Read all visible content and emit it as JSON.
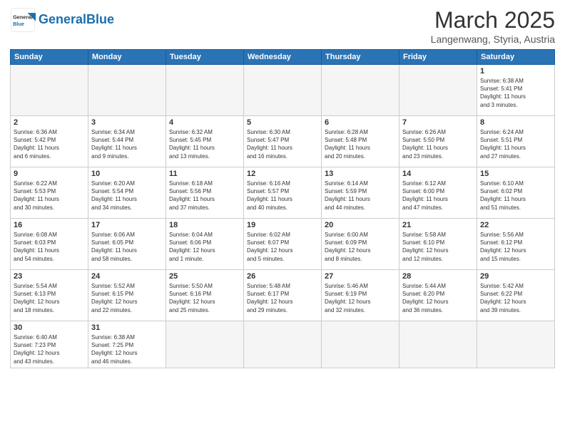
{
  "logo": {
    "text_general": "General",
    "text_blue": "Blue"
  },
  "title": "March 2025",
  "subtitle": "Langenwang, Styria, Austria",
  "weekdays": [
    "Sunday",
    "Monday",
    "Tuesday",
    "Wednesday",
    "Thursday",
    "Friday",
    "Saturday"
  ],
  "weeks": [
    [
      {
        "day": "",
        "info": ""
      },
      {
        "day": "",
        "info": ""
      },
      {
        "day": "",
        "info": ""
      },
      {
        "day": "",
        "info": ""
      },
      {
        "day": "",
        "info": ""
      },
      {
        "day": "",
        "info": ""
      },
      {
        "day": "1",
        "info": "Sunrise: 6:38 AM\nSunset: 5:41 PM\nDaylight: 11 hours\nand 3 minutes."
      }
    ],
    [
      {
        "day": "2",
        "info": "Sunrise: 6:36 AM\nSunset: 5:42 PM\nDaylight: 11 hours\nand 6 minutes."
      },
      {
        "day": "3",
        "info": "Sunrise: 6:34 AM\nSunset: 5:44 PM\nDaylight: 11 hours\nand 9 minutes."
      },
      {
        "day": "4",
        "info": "Sunrise: 6:32 AM\nSunset: 5:45 PM\nDaylight: 11 hours\nand 13 minutes."
      },
      {
        "day": "5",
        "info": "Sunrise: 6:30 AM\nSunset: 5:47 PM\nDaylight: 11 hours\nand 16 minutes."
      },
      {
        "day": "6",
        "info": "Sunrise: 6:28 AM\nSunset: 5:48 PM\nDaylight: 11 hours\nand 20 minutes."
      },
      {
        "day": "7",
        "info": "Sunrise: 6:26 AM\nSunset: 5:50 PM\nDaylight: 11 hours\nand 23 minutes."
      },
      {
        "day": "8",
        "info": "Sunrise: 6:24 AM\nSunset: 5:51 PM\nDaylight: 11 hours\nand 27 minutes."
      }
    ],
    [
      {
        "day": "9",
        "info": "Sunrise: 6:22 AM\nSunset: 5:53 PM\nDaylight: 11 hours\nand 30 minutes."
      },
      {
        "day": "10",
        "info": "Sunrise: 6:20 AM\nSunset: 5:54 PM\nDaylight: 11 hours\nand 34 minutes."
      },
      {
        "day": "11",
        "info": "Sunrise: 6:18 AM\nSunset: 5:56 PM\nDaylight: 11 hours\nand 37 minutes."
      },
      {
        "day": "12",
        "info": "Sunrise: 6:16 AM\nSunset: 5:57 PM\nDaylight: 11 hours\nand 40 minutes."
      },
      {
        "day": "13",
        "info": "Sunrise: 6:14 AM\nSunset: 5:59 PM\nDaylight: 11 hours\nand 44 minutes."
      },
      {
        "day": "14",
        "info": "Sunrise: 6:12 AM\nSunset: 6:00 PM\nDaylight: 11 hours\nand 47 minutes."
      },
      {
        "day": "15",
        "info": "Sunrise: 6:10 AM\nSunset: 6:02 PM\nDaylight: 11 hours\nand 51 minutes."
      }
    ],
    [
      {
        "day": "16",
        "info": "Sunrise: 6:08 AM\nSunset: 6:03 PM\nDaylight: 11 hours\nand 54 minutes."
      },
      {
        "day": "17",
        "info": "Sunrise: 6:06 AM\nSunset: 6:05 PM\nDaylight: 11 hours\nand 58 minutes."
      },
      {
        "day": "18",
        "info": "Sunrise: 6:04 AM\nSunset: 6:06 PM\nDaylight: 12 hours\nand 1 minute."
      },
      {
        "day": "19",
        "info": "Sunrise: 6:02 AM\nSunset: 6:07 PM\nDaylight: 12 hours\nand 5 minutes."
      },
      {
        "day": "20",
        "info": "Sunrise: 6:00 AM\nSunset: 6:09 PM\nDaylight: 12 hours\nand 8 minutes."
      },
      {
        "day": "21",
        "info": "Sunrise: 5:58 AM\nSunset: 6:10 PM\nDaylight: 12 hours\nand 12 minutes."
      },
      {
        "day": "22",
        "info": "Sunrise: 5:56 AM\nSunset: 6:12 PM\nDaylight: 12 hours\nand 15 minutes."
      }
    ],
    [
      {
        "day": "23",
        "info": "Sunrise: 5:54 AM\nSunset: 6:13 PM\nDaylight: 12 hours\nand 18 minutes."
      },
      {
        "day": "24",
        "info": "Sunrise: 5:52 AM\nSunset: 6:15 PM\nDaylight: 12 hours\nand 22 minutes."
      },
      {
        "day": "25",
        "info": "Sunrise: 5:50 AM\nSunset: 6:16 PM\nDaylight: 12 hours\nand 25 minutes."
      },
      {
        "day": "26",
        "info": "Sunrise: 5:48 AM\nSunset: 6:17 PM\nDaylight: 12 hours\nand 29 minutes."
      },
      {
        "day": "27",
        "info": "Sunrise: 5:46 AM\nSunset: 6:19 PM\nDaylight: 12 hours\nand 32 minutes."
      },
      {
        "day": "28",
        "info": "Sunrise: 5:44 AM\nSunset: 6:20 PM\nDaylight: 12 hours\nand 36 minutes."
      },
      {
        "day": "29",
        "info": "Sunrise: 5:42 AM\nSunset: 6:22 PM\nDaylight: 12 hours\nand 39 minutes."
      }
    ],
    [
      {
        "day": "30",
        "info": "Sunrise: 6:40 AM\nSunset: 7:23 PM\nDaylight: 12 hours\nand 43 minutes."
      },
      {
        "day": "31",
        "info": "Sunrise: 6:38 AM\nSunset: 7:25 PM\nDaylight: 12 hours\nand 46 minutes."
      },
      {
        "day": "",
        "info": ""
      },
      {
        "day": "",
        "info": ""
      },
      {
        "day": "",
        "info": ""
      },
      {
        "day": "",
        "info": ""
      },
      {
        "day": "",
        "info": ""
      }
    ]
  ]
}
